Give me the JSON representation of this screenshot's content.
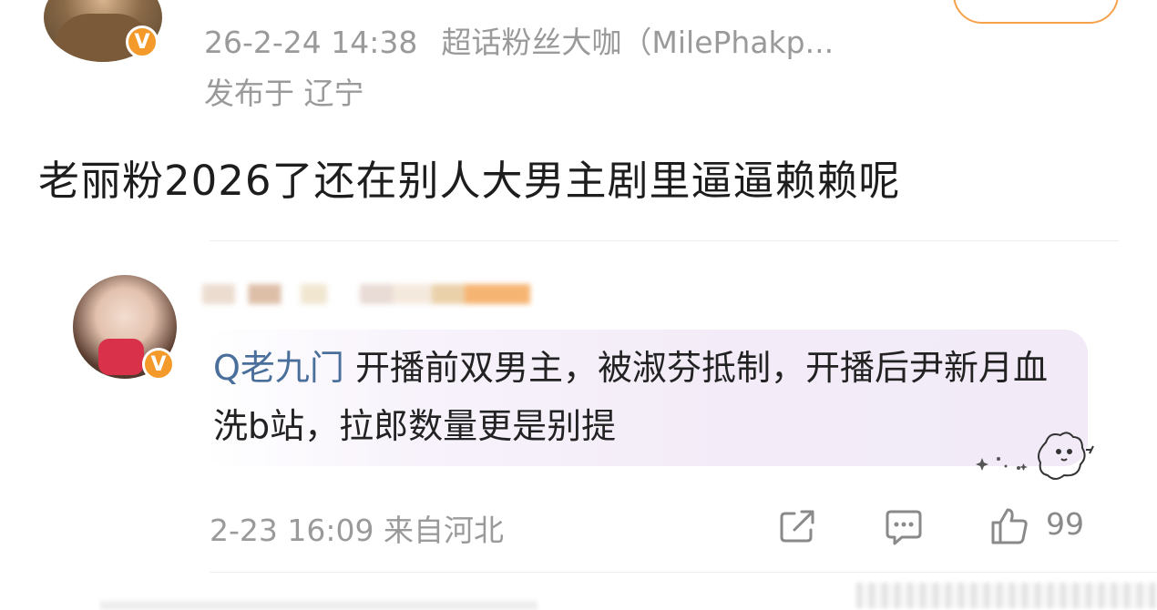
{
  "post": {
    "meta_line": "26-2-24 14:38",
    "badge": "超话粉丝大咖（MilePhakp...",
    "location": "发布于 辽宁",
    "text": "老丽粉2026了还在别人大男主剧里逼逼赖赖呢"
  },
  "comment": {
    "topic": "Q老九门",
    "text": " 开播前双男主，被淑芬抵制，开播后尹新月血洗b站，拉郎数量更是别提",
    "time": "2-23 16:09",
    "source": "来自河北",
    "like_count": "99",
    "icons": [
      "share-icon",
      "comment-icon",
      "like-icon"
    ]
  },
  "colors": {
    "verified_badge": "#f39a2b",
    "meta_gray": "#9a9a9a",
    "topic_blue": "#4a6f9b"
  }
}
